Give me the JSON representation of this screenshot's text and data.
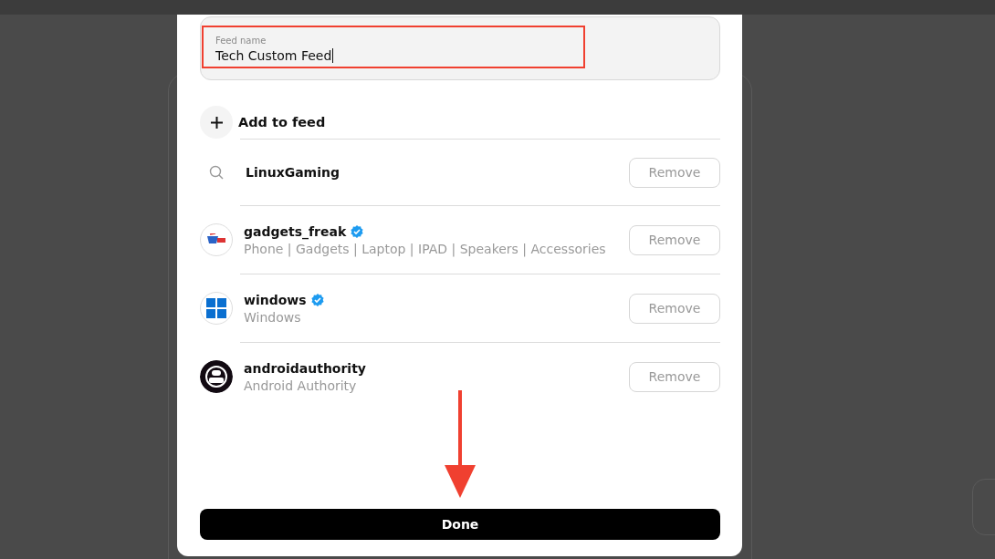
{
  "feed_name_field": {
    "label": "Feed name",
    "value": "Tech Custom Feed"
  },
  "add_button": {
    "label": "Add to feed"
  },
  "items": [
    {
      "kind": "search",
      "title": "LinuxGaming",
      "action": "Remove"
    },
    {
      "kind": "account",
      "title": "gadgets_freak",
      "verified": true,
      "subtitle": "Phone | Gadgets | Laptop | IPAD | Speakers | Accessories",
      "action": "Remove"
    },
    {
      "kind": "account",
      "title": "windows",
      "verified": true,
      "subtitle": "Windows",
      "action": "Remove"
    },
    {
      "kind": "account",
      "title": "androidauthority",
      "verified": false,
      "subtitle": "Android Authority",
      "action": "Remove"
    }
  ],
  "done_button": {
    "label": "Done"
  }
}
